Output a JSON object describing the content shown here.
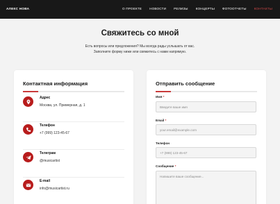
{
  "header": {
    "brand": "АЛЕКС НОВА",
    "nav": [
      "О ПРОЕКТЕ",
      "НОВОСТИ",
      "РЕЛИЗЫ",
      "КОНЦЕРТЫ",
      "ФОТООТЧЕТЫ",
      "КОНТАКТЫ"
    ],
    "active_nav": "КОНТАКТЫ"
  },
  "hero": {
    "title": "Свяжитесь со мной",
    "line1": "Есть вопросы или предложения? Мы всегда рады услышать от вас.",
    "line2": "Заполните форму ниже или свяжитесь с нами напрямую."
  },
  "contact_info": {
    "title": "Контактная информация",
    "items": [
      {
        "icon": "location-pin-icon",
        "label": "Адрес",
        "value": "Москва, ул. Примерная, д. 1"
      },
      {
        "icon": "phone-icon",
        "label": "Телефон",
        "value": "+7 (999) 123-45-67"
      },
      {
        "icon": "telegram-icon",
        "label": "Телеграм",
        "value": "@musicartist"
      },
      {
        "icon": "mail-icon",
        "label": "E-mail",
        "value": "info@musicartist.ru"
      }
    ]
  },
  "form": {
    "title": "Отправить сообщение",
    "name_label": "Имя",
    "name_placeholder": "Введите ваше имя",
    "email_label": "Email",
    "email_placeholder": "your.email@example.com",
    "phone_label": "Телефон",
    "phone_placeholder": "+7 (999) 123-45-67",
    "message_label": "Сообщение",
    "message_placeholder": "Напишите ваше сообщение...",
    "required_mark": "*"
  },
  "colors": {
    "accent": "#b81c1c",
    "header_bg": "#181818",
    "page_bg": "#f3f3f3"
  }
}
